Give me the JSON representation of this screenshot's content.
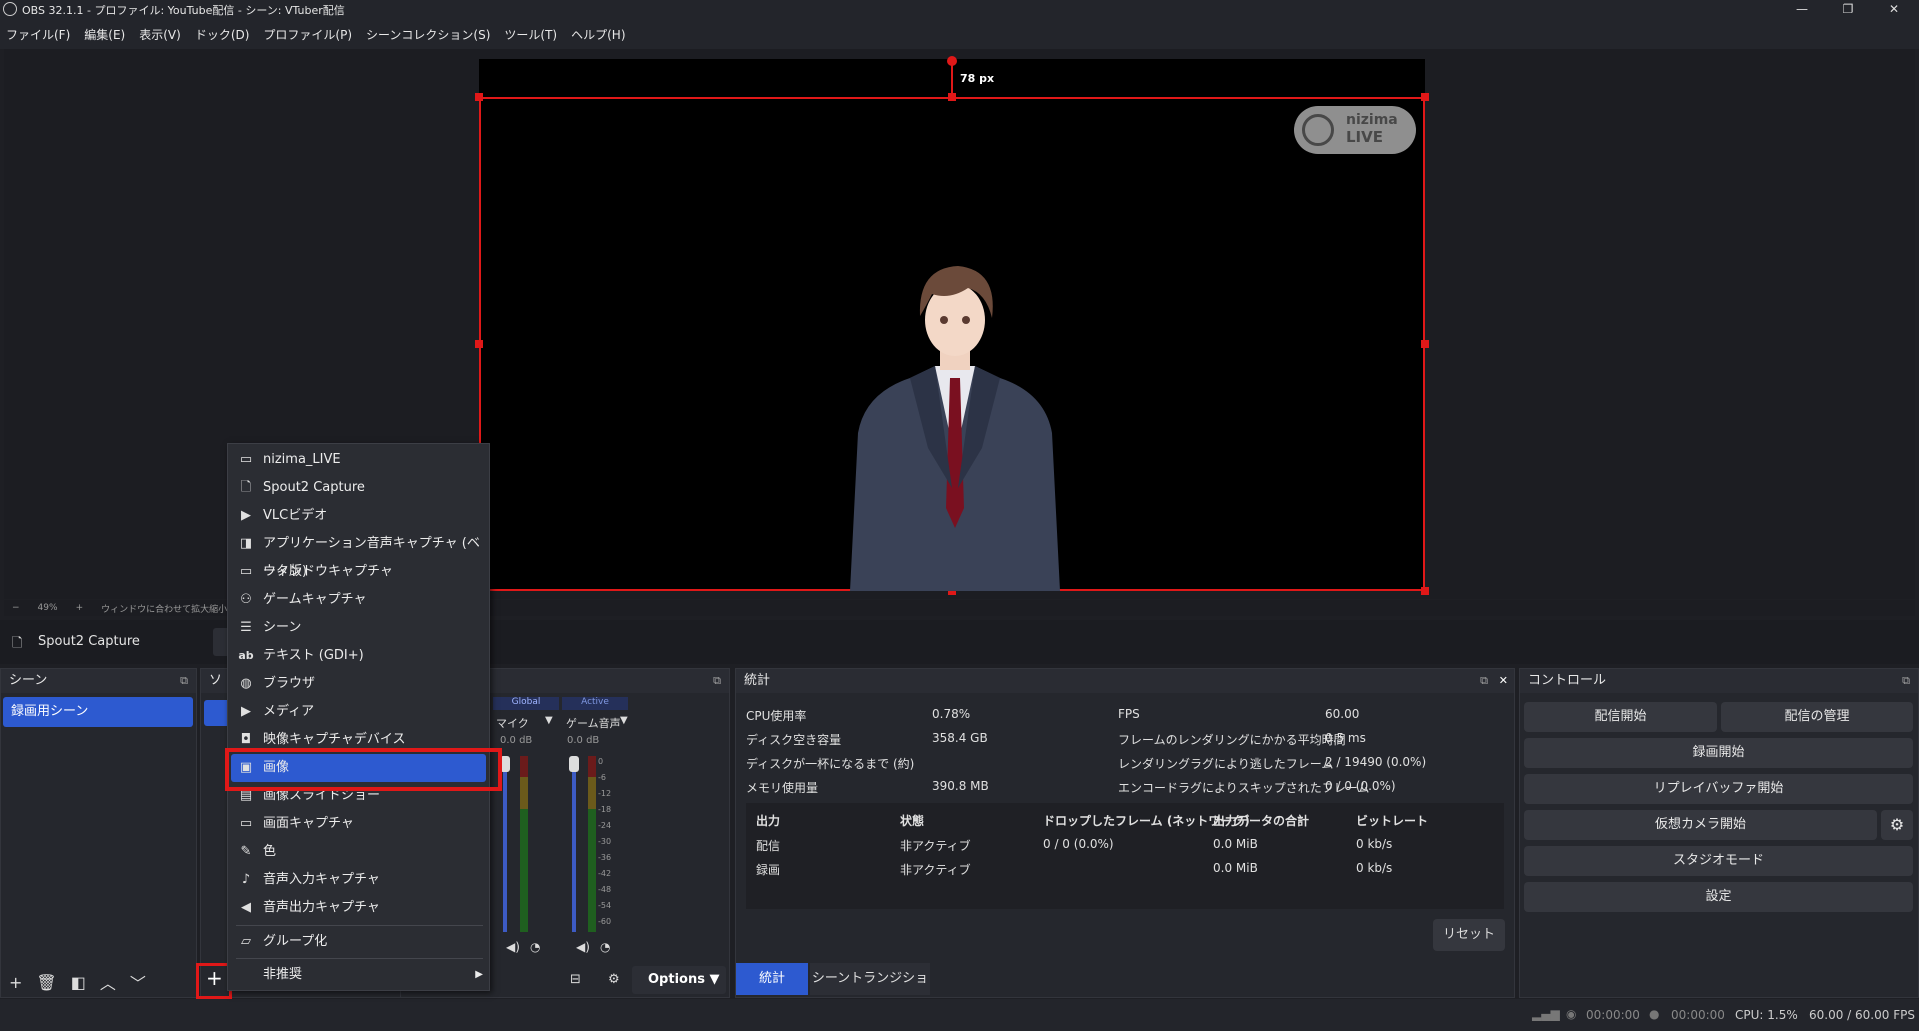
{
  "window": {
    "title": "OBS 32.1.1 - プロファイル: YouTube配信 - シーン: VTuber配信",
    "minimize": "—",
    "maximize": "❐",
    "close": "✕"
  },
  "menubar": [
    "ファイル(F)",
    "編集(E)",
    "表示(V)",
    "ドック(D)",
    "プロファイル(P)",
    "シーンコレクション(S)",
    "ツール(T)",
    "ヘルプ(H)"
  ],
  "preview": {
    "crop_label": "78 px",
    "watermark_line1": "nizima",
    "watermark_line2": "LIVE",
    "zoom_minus": "−",
    "zoom": "49%",
    "zoom_plus": "+",
    "fit_label": "ウィンドウに合わせて拡大縮小"
  },
  "source_bar": {
    "selected": "Spout2 Capture"
  },
  "scenes": {
    "title": "シーン",
    "items": [
      "録画用シーン"
    ]
  },
  "sources": {
    "title_partial": "ソ"
  },
  "mixer": {
    "tab_global": "Global",
    "tab_active": "Active",
    "channels": [
      {
        "name": "マイク",
        "db": "0.0 dB"
      },
      {
        "name": "ゲーム音声",
        "db": "0.0 dB"
      }
    ],
    "scale": [
      "0",
      "-6",
      "-12",
      "-18",
      "-24",
      "-30",
      "-36",
      "-42",
      "-48",
      "-54",
      "-60"
    ],
    "options": "Options"
  },
  "stats": {
    "title": "統計",
    "left": [
      {
        "label": "CPU使用率",
        "value": "0.78%"
      },
      {
        "label": "ディスク空き容量",
        "value": "358.4 GB"
      },
      {
        "label": "ディスクが一杯になるまで (約)",
        "value": ""
      },
      {
        "label": "メモリ使用量",
        "value": "390.8 MB"
      }
    ],
    "right": [
      {
        "label": "FPS",
        "value": "60.00"
      },
      {
        "label": "フレームのレンダリングにかかる平均時間",
        "value": "0.5 ms"
      },
      {
        "label": "レンダリングラグにより逃したフレーム",
        "value": "2 / 19490 (0.0%)"
      },
      {
        "label": "エンコードラグによりスキップされたフレーム",
        "value": "0 / 0 (0.0%)"
      }
    ],
    "headers": [
      "出力",
      "状態",
      "ドロップしたフレーム (ネットワーク)",
      "出力データの合計",
      "ビットレート"
    ],
    "rows": [
      [
        "配信",
        "非アクティブ",
        "0 / 0 (0.0%)",
        "0.0 MiB",
        "0 kb/s"
      ],
      [
        "録画",
        "非アクティブ",
        "",
        "0.0 MiB",
        "0 kb/s"
      ]
    ],
    "reset": "リセット"
  },
  "bottom_tabs": [
    "統計",
    "シーントランジション"
  ],
  "controls": {
    "title": "コントロール",
    "stream": "配信開始",
    "manage": "配信の管理",
    "record": "録画開始",
    "replay": "リプレイバッファ開始",
    "vcam": "仮想カメラ開始",
    "studio": "スタジオモード",
    "settings": "設定"
  },
  "statusbar": {
    "t1": "00:00:00",
    "t2": "00:00:00",
    "cpu": "CPU: 1.5%",
    "fps": "60.00 / 60.00 FPS"
  },
  "context_menu": {
    "items": [
      {
        "icon": "window-icon",
        "glyph": "▭",
        "label": "nizima_LIVE"
      },
      {
        "icon": "file-icon",
        "glyph": "🗋",
        "label": "Spout2 Capture"
      },
      {
        "icon": "play-icon",
        "glyph": "▶",
        "label": "VLCビデオ"
      },
      {
        "icon": "app-audio-icon",
        "glyph": "◨",
        "label": "アプリケーション音声キャプチャ (ベータ版)"
      },
      {
        "icon": "window-icon",
        "glyph": "▭",
        "label": "ウィンドウキャプチャ"
      },
      {
        "icon": "gamepad-icon",
        "glyph": "⚇",
        "label": "ゲームキャプチャ"
      },
      {
        "icon": "list-icon",
        "glyph": "☰",
        "label": "シーン"
      },
      {
        "icon": "text-icon",
        "glyph": "ab",
        "label": "テキスト (GDI+)"
      },
      {
        "icon": "globe-icon",
        "glyph": "◍",
        "label": "ブラウザ"
      },
      {
        "icon": "play-icon",
        "glyph": "▶",
        "label": "メディア"
      },
      {
        "icon": "camera-icon",
        "glyph": "◘",
        "label": "映像キャプチャデバイス"
      },
      {
        "icon": "image-icon",
        "glyph": "▣",
        "label": "画像"
      },
      {
        "icon": "slideshow-icon",
        "glyph": "▤",
        "label": "画像スライドショー"
      },
      {
        "icon": "monitor-icon",
        "glyph": "▭",
        "label": "画面キャプチャ"
      },
      {
        "icon": "brush-icon",
        "glyph": "✎",
        "label": "色"
      },
      {
        "icon": "mic-icon",
        "glyph": "♪",
        "label": "音声入力キャプチャ"
      },
      {
        "icon": "speaker-icon",
        "glyph": "◀",
        "label": "音声出力キャプチャ"
      }
    ],
    "group": "グループ化",
    "deprecated": "非推奨"
  },
  "colors": {
    "accent": "#2d5ad0",
    "highlight": "#e01818"
  }
}
